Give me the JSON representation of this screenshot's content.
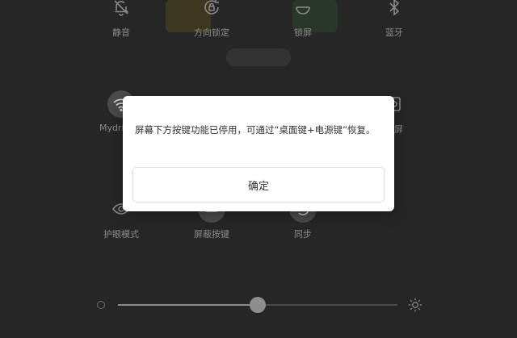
{
  "quick_settings": {
    "row1": [
      {
        "label": "静音",
        "icon": "bell-off-icon"
      },
      {
        "label": "方向锁定",
        "icon": "rotation-lock-icon"
      },
      {
        "label": "锁屏",
        "icon": "lock-screen-icon"
      },
      {
        "label": "蓝牙",
        "icon": "bluetooth-icon"
      }
    ],
    "row2": [
      {
        "label": "Mydrivers",
        "icon": "wifi-icon"
      },
      {
        "label": "",
        "icon": "blank-tile-icon"
      },
      {
        "label": "",
        "icon": "blank-tile-icon"
      },
      {
        "label": "录屏",
        "icon": "screen-record-icon"
      }
    ],
    "row3": [
      {
        "label": "护眼模式",
        "icon": "eye-icon"
      },
      {
        "label": "屏蔽按键",
        "icon": "block-keys-icon"
      },
      {
        "label": "同步",
        "icon": "sync-icon"
      }
    ]
  },
  "brightness": {
    "value": 0.5
  },
  "dialog": {
    "message": "屏幕下方按键功能已停用，可通过“桌面键+电源键”恢复。",
    "confirm_label": "确定"
  },
  "colors": {
    "background": "#262626",
    "dialog_bg": "#ffffff",
    "text_dim": "#8a8a8a",
    "text_dark": "#333333"
  }
}
